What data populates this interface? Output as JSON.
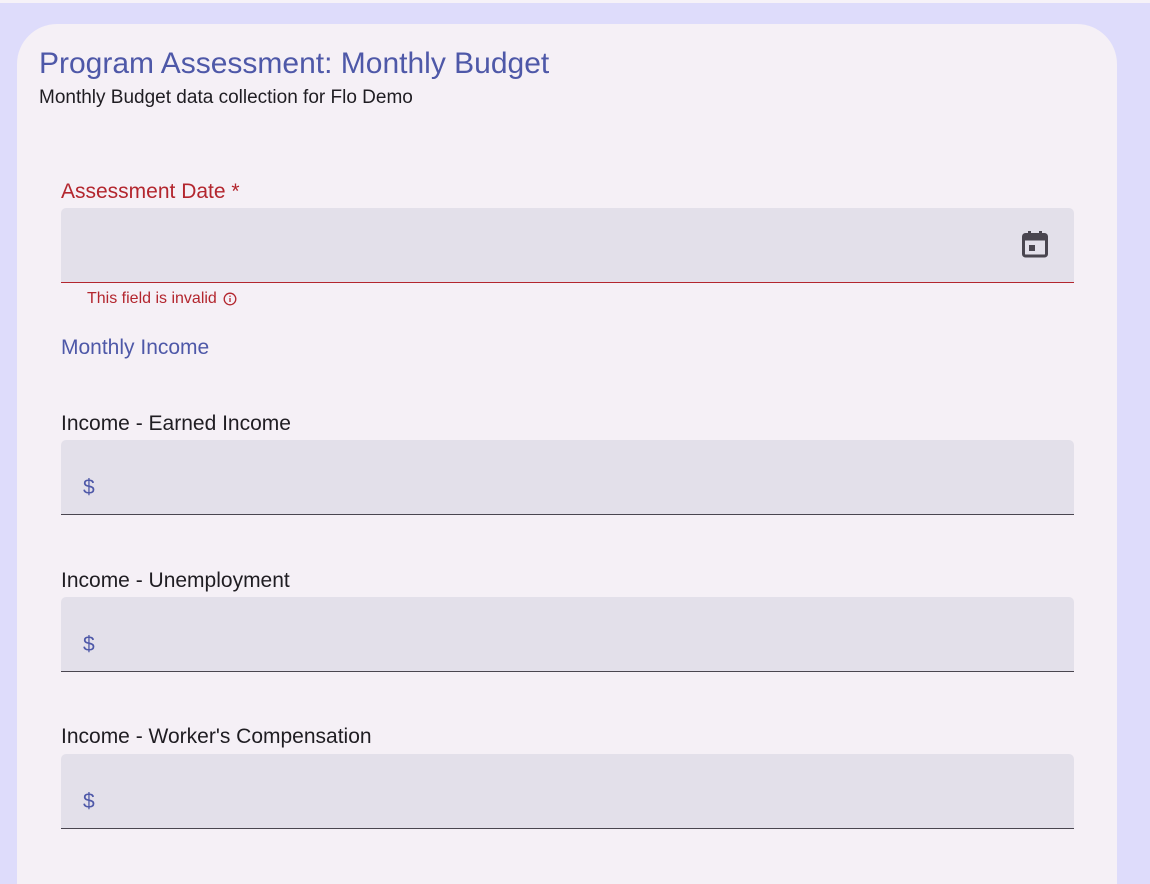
{
  "form": {
    "title": "Program Assessment: Monthly Budget",
    "subtitle": "Monthly Budget data collection for Flo Demo"
  },
  "assessment_date": {
    "label": "Assessment Date *",
    "value": "",
    "icon": "calendar-icon",
    "error": "This field is invalid",
    "error_icon": "info-icon"
  },
  "sections": {
    "monthly_income": "Monthly Income"
  },
  "income_fields": [
    {
      "label": "Income - Earned Income",
      "prefix": "$",
      "value": ""
    },
    {
      "label": "Income - Unemployment",
      "prefix": "$",
      "value": ""
    },
    {
      "label": "Income - Worker's Compensation",
      "prefix": "$",
      "value": ""
    }
  ],
  "colors": {
    "background": "#dedcfb",
    "card": "#f5f0f6",
    "accent": "#4e58a8",
    "error": "#b3262e",
    "field_fill": "#e3e0ea"
  }
}
